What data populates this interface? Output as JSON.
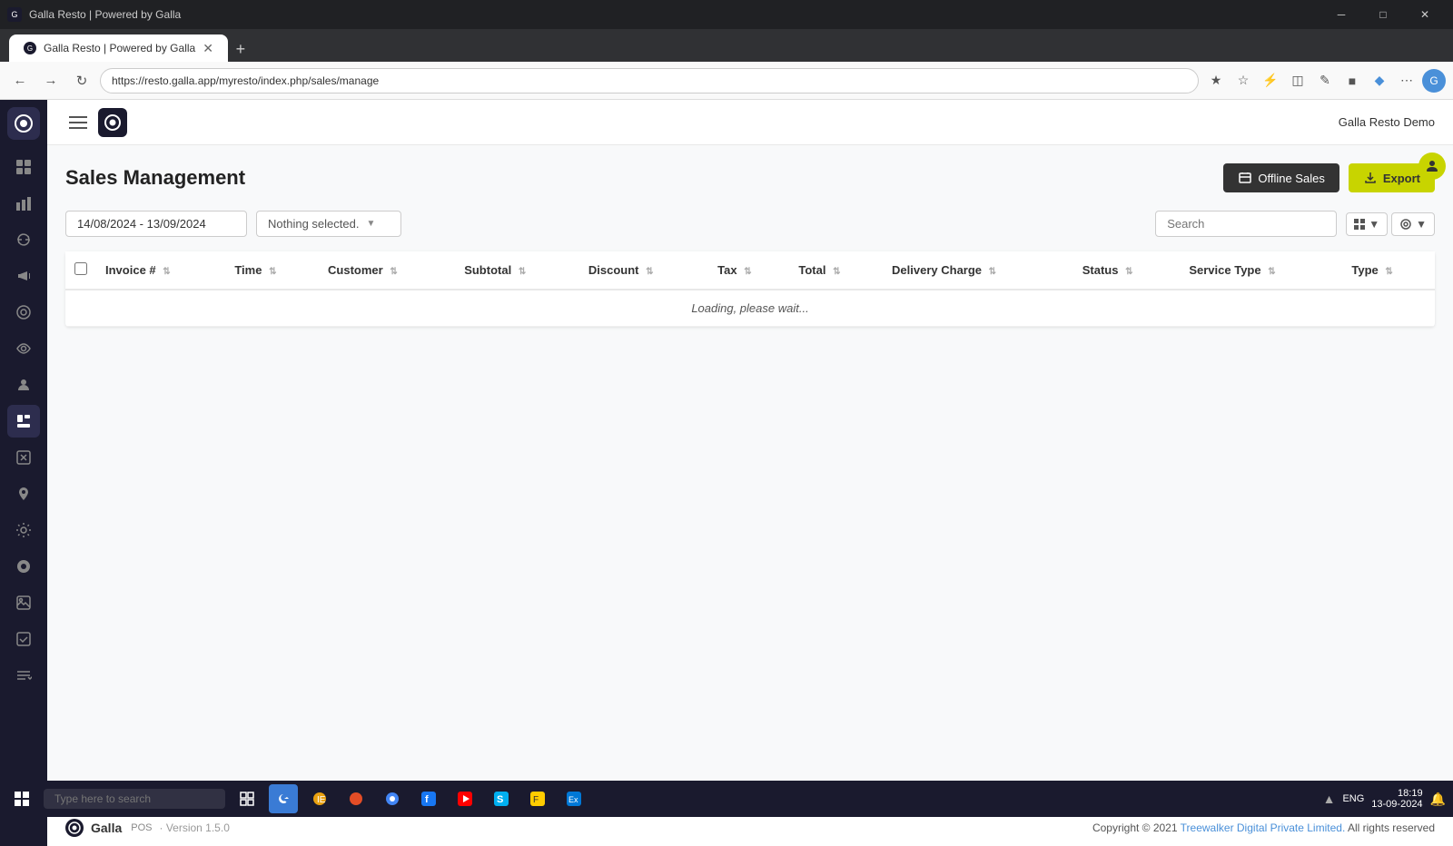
{
  "browser": {
    "tab_label": "Galla Resto | Powered by Galla",
    "url": "https://resto.galla.app/myresto/index.php/sales/manage",
    "new_tab_icon": "+",
    "profile_initial": "G"
  },
  "header": {
    "app_name": "Galla Resto Demo"
  },
  "page": {
    "title": "Sales Management",
    "btn_offline": "Offline Sales",
    "btn_export": "Export"
  },
  "filters": {
    "date_range": "14/08/2024 - 13/09/2024",
    "dropdown_placeholder": "Nothing selected.",
    "search_placeholder": "Search"
  },
  "table": {
    "columns": [
      "Invoice #",
      "Time",
      "Customer",
      "Subtotal",
      "Discount",
      "Tax",
      "Total",
      "Delivery Charge",
      "Status",
      "Service Type",
      "Type"
    ],
    "loading_text": "Loading, please wait..."
  },
  "footer": {
    "logo_text": "Galla",
    "pos_label": "POS",
    "version_label": "· Version 1.5.0",
    "copyright": "Copyright © 2021",
    "company": "Treewalker Digital Private Limited.",
    "rights": " All rights reserved"
  },
  "sidebar": {
    "items": [
      {
        "icon": "⊙",
        "name": "dashboard"
      },
      {
        "icon": "📊",
        "name": "analytics"
      },
      {
        "icon": "🔄",
        "name": "sync"
      },
      {
        "icon": "📣",
        "name": "marketing"
      },
      {
        "icon": "◉",
        "name": "reports"
      },
      {
        "icon": "👁",
        "name": "visibility"
      },
      {
        "icon": "👤",
        "name": "users"
      },
      {
        "icon": "💼",
        "name": "sales"
      },
      {
        "icon": "🏷",
        "name": "promotions"
      },
      {
        "icon": "📍",
        "name": "locations"
      },
      {
        "icon": "⚙",
        "name": "settings"
      },
      {
        "icon": "🔵",
        "name": "integrations"
      },
      {
        "icon": "📷",
        "name": "media"
      },
      {
        "icon": "✅",
        "name": "checklist1"
      },
      {
        "icon": "✔",
        "name": "checklist2"
      }
    ]
  },
  "taskbar": {
    "search_placeholder": "Type here to search",
    "time": "18:19",
    "date": "13-09-2024",
    "language": "ENG"
  },
  "wincontrols": {
    "minimize": "─",
    "maximize": "□",
    "close": "✕"
  }
}
